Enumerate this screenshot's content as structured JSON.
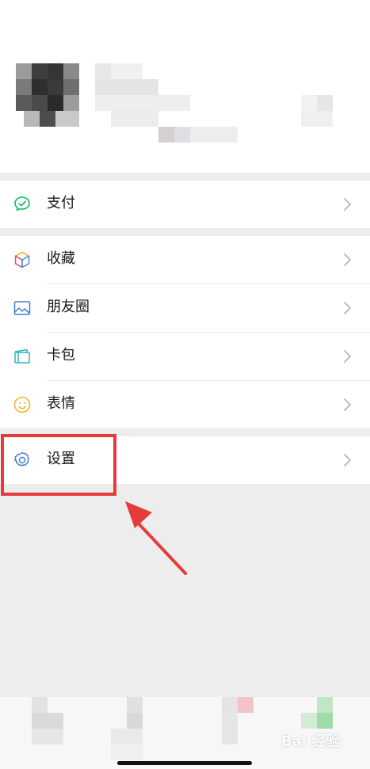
{
  "menu": {
    "pay": {
      "label": "支付",
      "icon": "wechat-pay-icon"
    },
    "favorites": {
      "label": "收藏",
      "icon": "cube-icon"
    },
    "moments": {
      "label": "朋友圈",
      "icon": "image-icon"
    },
    "cards": {
      "label": "卡包",
      "icon": "card-icon"
    },
    "stickers": {
      "label": "表情",
      "icon": "smiley-icon"
    },
    "settings": {
      "label": "设置",
      "icon": "gear-icon"
    }
  },
  "watermark": {
    "text": "Bai 经验"
  },
  "colors": {
    "background": "#ededed",
    "card": "#ffffff",
    "highlight": "#e63b3b",
    "pay_green": "#07c160"
  }
}
